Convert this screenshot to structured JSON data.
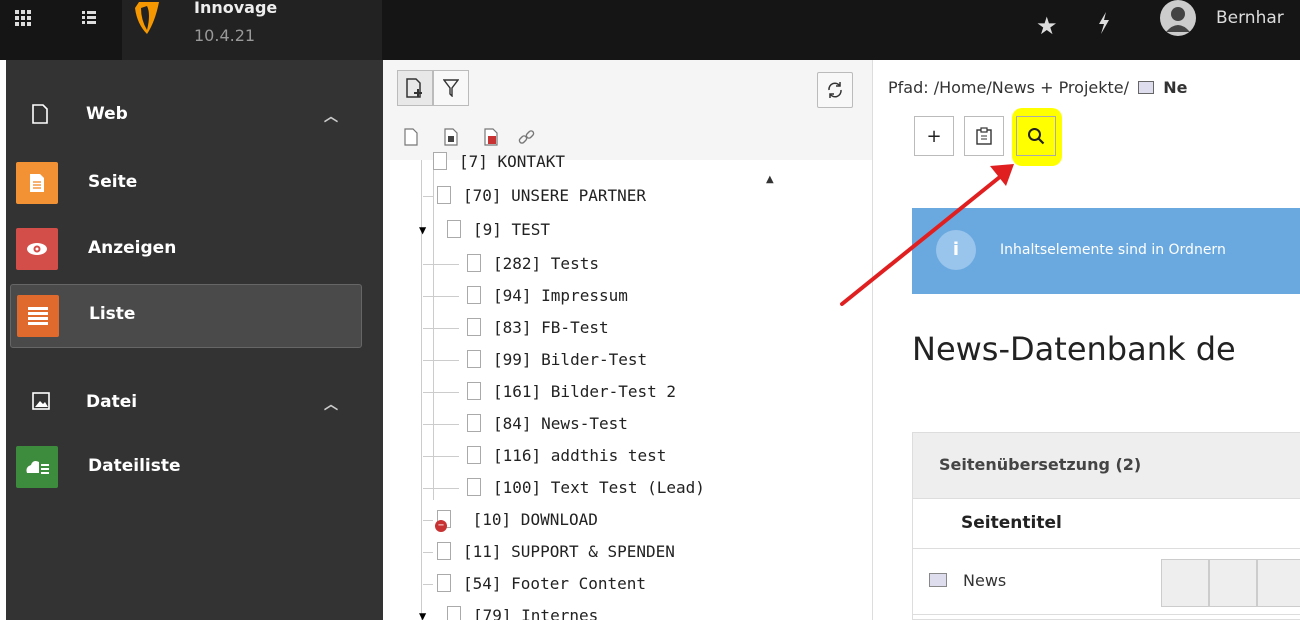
{
  "topbar": {
    "site_name": "Innovage",
    "site_version": "10.4.21",
    "user_name": "Bernhar"
  },
  "modules": {
    "web": {
      "label": "Web"
    },
    "items_web": [
      {
        "label": "Seite",
        "color": "#f39234"
      },
      {
        "label": "Anzeigen",
        "color": "#d34d49"
      },
      {
        "label": "Liste",
        "color": "#e06a2d"
      }
    ],
    "file": {
      "label": "Datei"
    },
    "items_file": [
      {
        "label": "Dateiliste",
        "color": "#3d8c3d"
      }
    ]
  },
  "tree": {
    "nodes": [
      "[7] KONTAKT",
      "[70] UNSERE PARTNER",
      "[9] TEST",
      "[282] Tests",
      "[94] Impressum",
      "[83] FB-Test",
      "[99] Bilder-Test",
      "[161] Bilder-Test 2",
      "[84] News-Test",
      "[116] addthis test",
      "[100] Text Test (Lead)",
      "[10] DOWNLOAD",
      "[11] SUPPORT & SPENDEN",
      "[54] Footer Content",
      "[79] Internes"
    ]
  },
  "content": {
    "breadcrumb_prefix": "Pfad: /Home/News + Projekte/",
    "breadcrumb_current": "Ne",
    "info_text": "Inhaltselemente sind in Ordnern",
    "page_title": "News-Datenbank de",
    "panel_title": "Seitenübersetzung (2)",
    "column_title": "Seitentitel",
    "row_title": "News"
  },
  "colors": {
    "highlight": "#ffff00",
    "annotation_arrow": "#e02020",
    "info_bg": "#6aa9e0"
  }
}
